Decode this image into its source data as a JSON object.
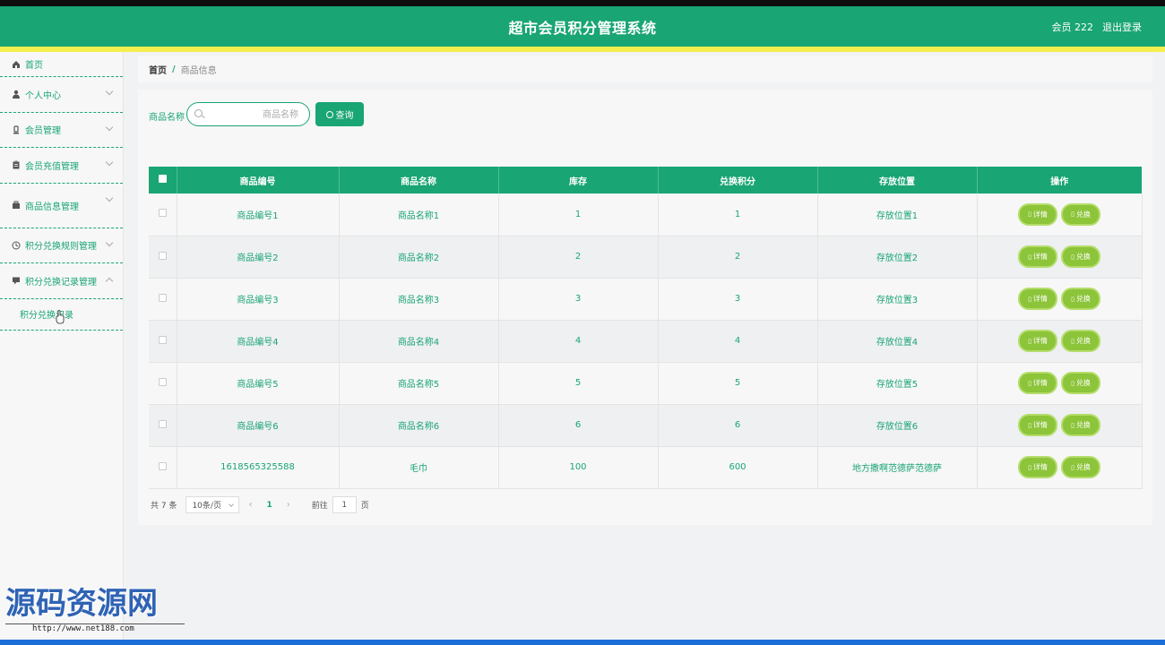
{
  "header": {
    "title": "超市会员积分管理系统",
    "user": "会员 222",
    "logout": "退出登录"
  },
  "sidebar": {
    "items": [
      {
        "label": "首页",
        "icon": "home-icon"
      },
      {
        "label": "个人中心",
        "icon": "user-icon"
      },
      {
        "label": "会员管理",
        "icon": "member-icon"
      },
      {
        "label": "会员充值管理",
        "icon": "clipboard-icon"
      },
      {
        "label": "商品信息管理",
        "icon": "box-icon"
      },
      {
        "label": "积分兑换规则管理",
        "icon": "clock-icon"
      },
      {
        "label": "积分兑换记录管理",
        "icon": "message-icon"
      }
    ],
    "submenu": {
      "label": "积分兑换记录"
    }
  },
  "breadcrumb": {
    "home": "首页",
    "separator": "/",
    "current": "商品信息"
  },
  "search": {
    "label": "商品名称",
    "placeholder": "商品名称",
    "button": "查询"
  },
  "table": {
    "headers": [
      "商品编号",
      "商品名称",
      "库存",
      "兑换积分",
      "存放位置",
      "操作"
    ],
    "rows": [
      [
        "商品编号1",
        "商品名称1",
        "1",
        "1",
        "存放位置1"
      ],
      [
        "商品编号2",
        "商品名称2",
        "2",
        "2",
        "存放位置2"
      ],
      [
        "商品编号3",
        "商品名称3",
        "3",
        "3",
        "存放位置3"
      ],
      [
        "商品编号4",
        "商品名称4",
        "4",
        "4",
        "存放位置4"
      ],
      [
        "商品编号5",
        "商品名称5",
        "5",
        "5",
        "存放位置5"
      ],
      [
        "商品编号6",
        "商品名称6",
        "6",
        "6",
        "存放位置6"
      ],
      [
        "1618565325588",
        "毛巾",
        "100",
        "600",
        "地方撒啊范德萨范德萨"
      ]
    ],
    "actions": {
      "detail": "详情",
      "exchange": "兑换"
    }
  },
  "pagination": {
    "total": "共 7 条",
    "page_size": "10条/页",
    "prev": "‹",
    "current_page": "1",
    "next": "›",
    "goto_label": "前往",
    "goto_value": "1",
    "goto_suffix": "页"
  },
  "watermark": {
    "text": "源码资源网",
    "url": "http://www.net188.com"
  },
  "colors": {
    "primary": "#19a574",
    "accent_yellow": "#f5ee4f",
    "action_green": "#8cc43a"
  }
}
